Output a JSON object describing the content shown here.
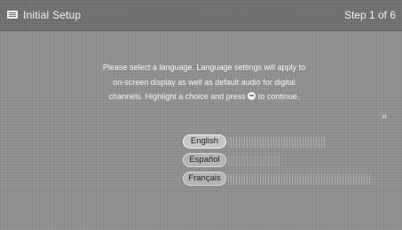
{
  "header": {
    "title": "Initial Setup",
    "step": "Step 1 of 6",
    "icon": "setup-menu-icon"
  },
  "instructions": {
    "line1": "Please select a language. Language settings will apply to",
    "line2": "on-screen display as well as default audio for digital",
    "line3_prefix": "channels. Highlight a choice and press",
    "line3_suffix": "to continue.",
    "button_icon": "enter-button-icon"
  },
  "languages": {
    "selected": "English",
    "options": [
      {
        "label": "English"
      },
      {
        "label": "Español"
      },
      {
        "label": "Français"
      }
    ]
  },
  "colors": {
    "background": "#8f8f8f",
    "header": "#6e6e6e",
    "text": "#f4f4f4"
  }
}
